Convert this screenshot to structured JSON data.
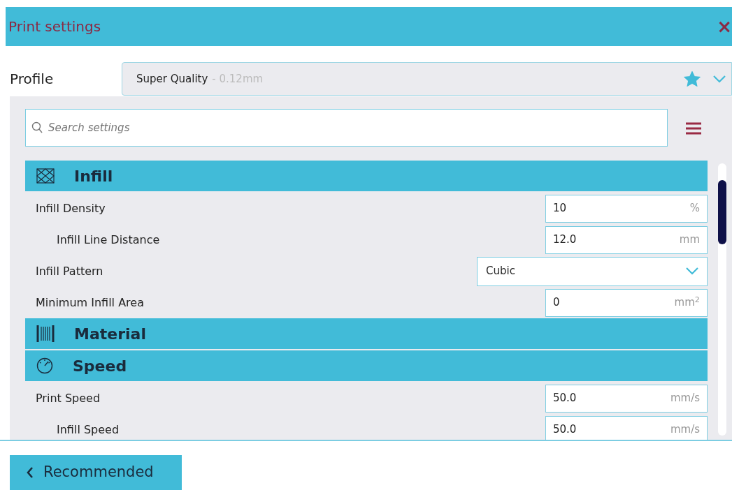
{
  "window": {
    "title": "Print settings",
    "close": "×"
  },
  "profile": {
    "label": "Profile",
    "name": "Super Quality",
    "detail": "- 0.12mm",
    "favorite": true
  },
  "search": {
    "placeholder": "Search settings"
  },
  "sections": [
    {
      "title": "Infill",
      "settings": [
        {
          "label": "Infill Density",
          "kind": "number",
          "value": "10",
          "unit": "%",
          "children": [
            {
              "label": "Infill Line Distance",
              "kind": "number",
              "value": "12.0",
              "unit": "mm"
            }
          ]
        },
        {
          "label": "Infill Pattern",
          "kind": "dropdown",
          "value": "Cubic"
        },
        {
          "label": "Minimum Infill Area",
          "kind": "number",
          "value": "0",
          "unit": "mm$^{2}$"
        }
      ]
    },
    {
      "title": "Material"
    },
    {
      "title": "Speed",
      "settings": [
        {
          "label": "Print Speed",
          "kind": "number",
          "value": "50.0",
          "unit": "mm/s",
          "children": [
            {
              "label": "Infill Speed",
              "kind": "number",
              "value": "50.0",
              "unit": "mm/s"
            }
          ]
        }
      ]
    }
  ],
  "footer": {
    "button": "Recommended"
  }
}
